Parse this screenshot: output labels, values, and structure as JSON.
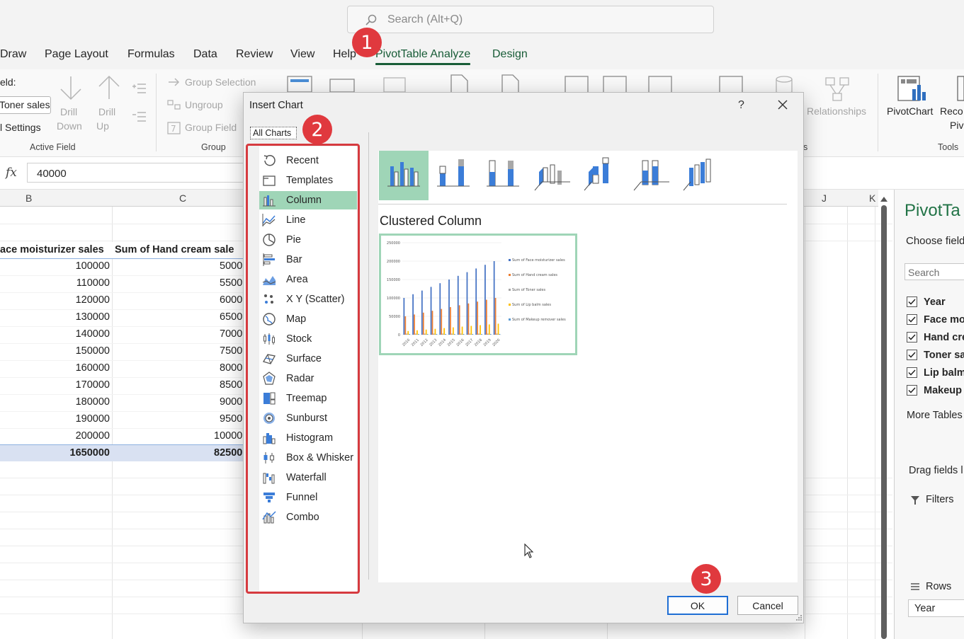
{
  "search": {
    "placeholder": "Search (Alt+Q)",
    "icon": "search-icon"
  },
  "tabs": [
    "Draw",
    "Page Layout",
    "Formulas",
    "Data",
    "Review",
    "View",
    "Help",
    "PivotTable Analyze",
    "Design"
  ],
  "ribbon": {
    "active_field": {
      "field_label": "eld:",
      "field_value": "Toner sales",
      "field_settings": "l Settings",
      "drill_down": [
        "Drill",
        "Down"
      ],
      "drill_up": [
        "Drill",
        "Up"
      ],
      "group_label": "Active Field"
    },
    "group": {
      "group_selection": "Group Selection",
      "ungroup": "Ungroup",
      "group_field": "Group Field",
      "group_label": "Group"
    },
    "relationships": "Relationships",
    "calc_group_label": "s",
    "pivotchart": "PivotChart",
    "recommended": [
      "Reco",
      "Piv"
    ],
    "tools_label": "Tools"
  },
  "formula_bar": {
    "fx": "fx",
    "value": "40000"
  },
  "grid": {
    "col_b": "B",
    "col_c": "C",
    "col_j": "J",
    "col_k": "K",
    "header_b": "ace moisturizer sales",
    "header_c": "Sum of Hand cream sale",
    "col_b_values": [
      "100000",
      "110000",
      "120000",
      "130000",
      "140000",
      "150000",
      "160000",
      "170000",
      "180000",
      "190000",
      "200000"
    ],
    "col_c_values": [
      "5000",
      "5500",
      "6000",
      "6500",
      "7000",
      "7500",
      "8000",
      "8500",
      "9000",
      "9500",
      "10000"
    ],
    "total_b": "1650000",
    "total_c": "82500"
  },
  "pivot_pane": {
    "title": "PivotTa",
    "choose": "Choose field",
    "search_placeholder": "Search",
    "fields": [
      "Year",
      "Face mo",
      "Hand cre",
      "Toner sa",
      "Lip balm",
      "Makeup"
    ],
    "more_tables": "More Tables",
    "drag": "Drag fields l",
    "filters": "Filters",
    "rows": "Rows",
    "rows_value": "Year"
  },
  "dialog": {
    "title": "Insert Chart",
    "help": "?",
    "tab": "All Charts",
    "chart_types": [
      {
        "label": "Recent",
        "icon": "recent-icon"
      },
      {
        "label": "Templates",
        "icon": "templates-icon"
      },
      {
        "label": "Column",
        "icon": "column-chart-icon"
      },
      {
        "label": "Line",
        "icon": "line-chart-icon"
      },
      {
        "label": "Pie",
        "icon": "pie-chart-icon"
      },
      {
        "label": "Bar",
        "icon": "bar-chart-icon"
      },
      {
        "label": "Area",
        "icon": "area-chart-icon"
      },
      {
        "label": "X Y (Scatter)",
        "icon": "scatter-chart-icon"
      },
      {
        "label": "Map",
        "icon": "map-chart-icon"
      },
      {
        "label": "Stock",
        "icon": "stock-chart-icon"
      },
      {
        "label": "Surface",
        "icon": "surface-chart-icon"
      },
      {
        "label": "Radar",
        "icon": "radar-chart-icon"
      },
      {
        "label": "Treemap",
        "icon": "treemap-chart-icon"
      },
      {
        "label": "Sunburst",
        "icon": "sunburst-chart-icon"
      },
      {
        "label": "Histogram",
        "icon": "histogram-chart-icon"
      },
      {
        "label": "Box & Whisker",
        "icon": "box-whisker-chart-icon"
      },
      {
        "label": "Waterfall",
        "icon": "waterfall-chart-icon"
      },
      {
        "label": "Funnel",
        "icon": "funnel-chart-icon"
      },
      {
        "label": "Combo",
        "icon": "combo-chart-icon"
      }
    ],
    "selected_type": "Column",
    "subtype_name": "Clustered Column",
    "ok": "OK",
    "cancel": "Cancel"
  },
  "preview_chart": {
    "y_ticks": [
      "250000",
      "200000",
      "150000",
      "100000",
      "50000",
      "0"
    ],
    "x_labels": [
      "2010",
      "2011",
      "2012",
      "2013",
      "2014",
      "2015",
      "2016",
      "2017",
      "2018",
      "2019",
      "2020"
    ],
    "legend": [
      "Sum of Face moisturizer sales",
      "Sum of Hand cream sales",
      "Sum of Toner sales",
      "Sum of Lip balm sales",
      "Sum of Makeup remover sales"
    ],
    "series_colors": [
      "#4472c4",
      "#ed7d31",
      "#a5a5a5",
      "#ffc000",
      "#5b9bd5"
    ]
  },
  "chart_data": {
    "type": "bar",
    "categories": [
      "2010",
      "2011",
      "2012",
      "2013",
      "2014",
      "2015",
      "2016",
      "2017",
      "2018",
      "2019",
      "2020"
    ],
    "series": [
      {
        "name": "Sum of Face moisturizer sales",
        "values": [
          100000,
          110000,
          120000,
          130000,
          140000,
          150000,
          160000,
          170000,
          180000,
          190000,
          200000
        ]
      },
      {
        "name": "Sum of Hand cream sales",
        "values": [
          50000,
          55000,
          60000,
          65000,
          70000,
          75000,
          80000,
          85000,
          90000,
          95000,
          100000
        ]
      },
      {
        "name": "Sum of Toner sales",
        "values": [
          3000,
          3000,
          3000,
          3000,
          3000,
          3000,
          3000,
          3000,
          3000,
          3000,
          3000
        ]
      },
      {
        "name": "Sum of Lip balm sales",
        "values": [
          10000,
          12000,
          14000,
          16000,
          18000,
          20000,
          22000,
          24000,
          26000,
          28000,
          30000
        ]
      },
      {
        "name": "Sum of Makeup remover sales",
        "values": [
          2000,
          2000,
          2000,
          2000,
          2000,
          2000,
          2000,
          2000,
          2000,
          2000,
          2000
        ]
      }
    ],
    "ylim": [
      0,
      250000
    ]
  },
  "callouts": [
    "1",
    "2",
    "3"
  ]
}
